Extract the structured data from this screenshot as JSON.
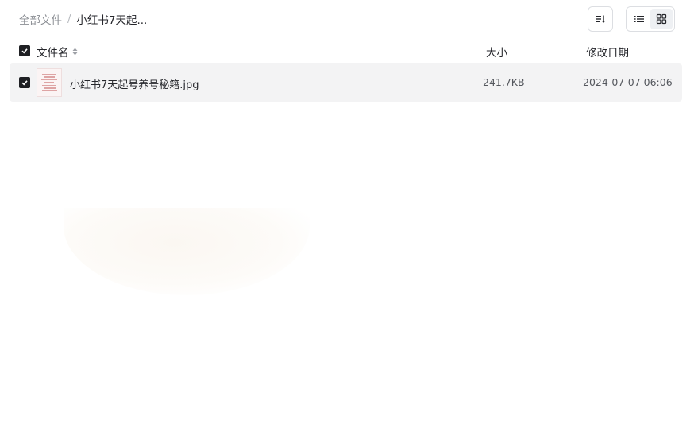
{
  "breadcrumb": {
    "root": "全部文件",
    "separator": "/",
    "current": "小红书7天起..."
  },
  "toolbar": {
    "sort_icon": "sort-icon",
    "view_list_icon": "list-view-icon",
    "view_grid_icon": "grid-view-icon"
  },
  "table": {
    "columns": {
      "name": "文件名",
      "size": "大小",
      "date": "修改日期"
    },
    "rows": [
      {
        "name": "小红书7天起号养号秘籍.jpg",
        "size": "241.7KB",
        "date": "2024-07-07 06:06",
        "checked": true
      }
    ]
  },
  "colors": {
    "accent_dark": "#1f2024",
    "row_bg": "#f3f3f4",
    "muted_text": "#8a8d93"
  }
}
